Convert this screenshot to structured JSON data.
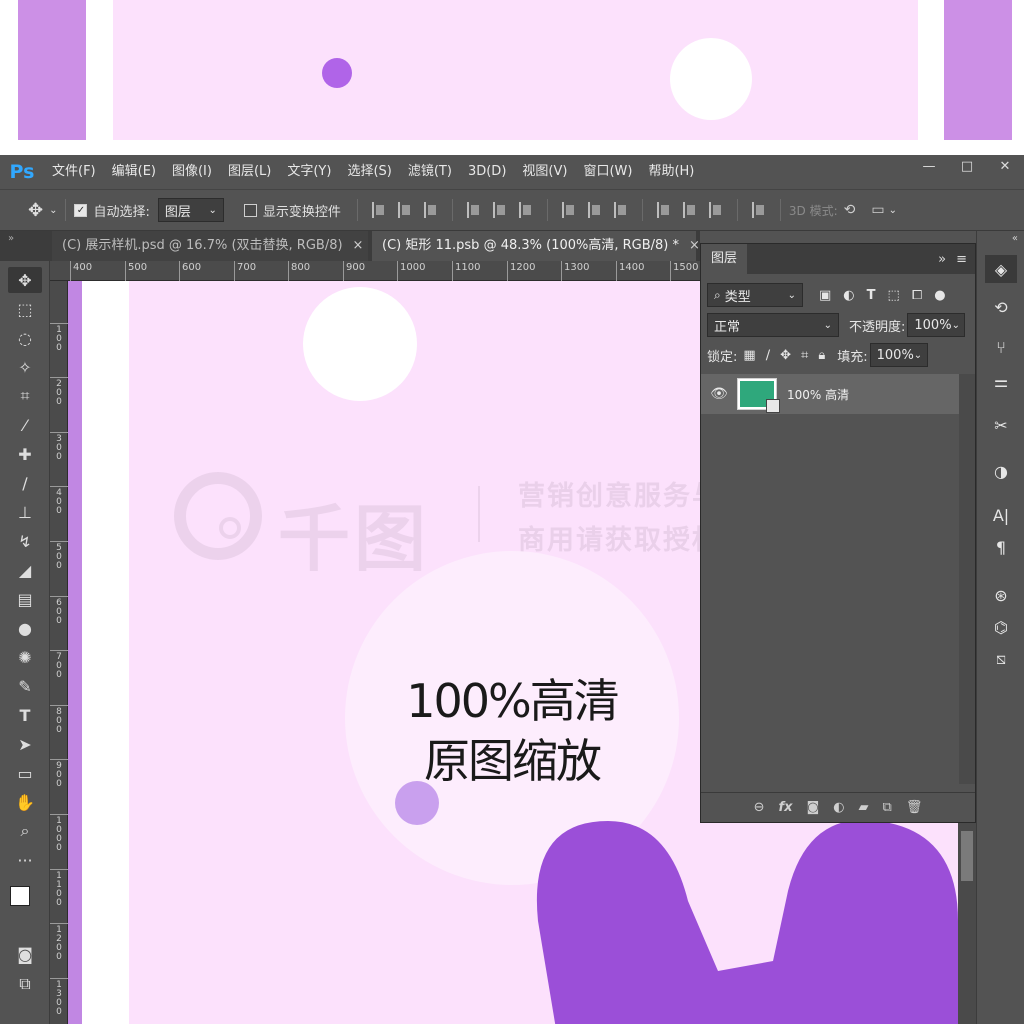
{
  "preview": {},
  "app": {
    "logo": "Ps",
    "menu": [
      "文件(F)",
      "编辑(E)",
      "图像(I)",
      "图层(L)",
      "文字(Y)",
      "选择(S)",
      "滤镜(T)",
      "3D(D)",
      "视图(V)",
      "窗口(W)",
      "帮助(H)"
    ],
    "window_buttons": [
      "—",
      "□",
      "✕"
    ]
  },
  "options_bar": {
    "auto_select_label": "自动选择:",
    "auto_select_value": "图层",
    "show_transform_label": "显示变换控件",
    "mode_3d_label": "3D 模式:"
  },
  "tabs": [
    {
      "label": "(C) 展示样机.psd @ 16.7% (双击替换, RGB/8)",
      "close": "×"
    },
    {
      "label": "(C) 矩形 11.psb @ 48.3% (100%高清, RGB/8) *",
      "close": "×"
    }
  ],
  "ruler": {
    "top_ticks": [
      "400",
      "500",
      "600",
      "700",
      "800",
      "900",
      "1000",
      "1100",
      "1200",
      "1300",
      "1400",
      "1500"
    ],
    "left_ticks": [
      "1\n0\n0",
      "2\n0\n0",
      "3\n0\n0",
      "4\n0\n0",
      "5\n0\n0",
      "6\n0\n0",
      "7\n0\n0",
      "8\n0\n0",
      "9\n0\n0",
      "1\n0\n0\n0",
      "1\n1\n0\n0",
      "1\n2\n0\n0",
      "1\n3\n0\n0"
    ]
  },
  "canvas": {
    "headline_line1": "100%高清",
    "headline_line2": "原图缩放",
    "watermark_brand": "千图",
    "watermark_line1": "营销创意服务与协作平台",
    "watermark_line2": "商用请获取授权",
    "colors": {
      "background": "#fce1fc",
      "accent_purple": "#9b4fd8"
    }
  },
  "layers_panel": {
    "title": "图层",
    "filter_label": "类型",
    "blend_mode": "正常",
    "opacity_label": "不透明度:",
    "opacity_value": "100%",
    "lock_label": "锁定:",
    "fill_label": "填充:",
    "fill_value": "100%",
    "layers": [
      {
        "name": "100% 高清",
        "visible": true,
        "thumb_color": "#2fa87c"
      }
    ],
    "footer_icons": [
      "link-icon",
      "fx-icon",
      "mask-icon",
      "adjustment-icon",
      "folder-icon",
      "new-layer-icon",
      "trash-icon"
    ],
    "footer_fx_label": "fx"
  },
  "right_dock": {
    "char_label": "A|",
    "para_label": "¶"
  }
}
